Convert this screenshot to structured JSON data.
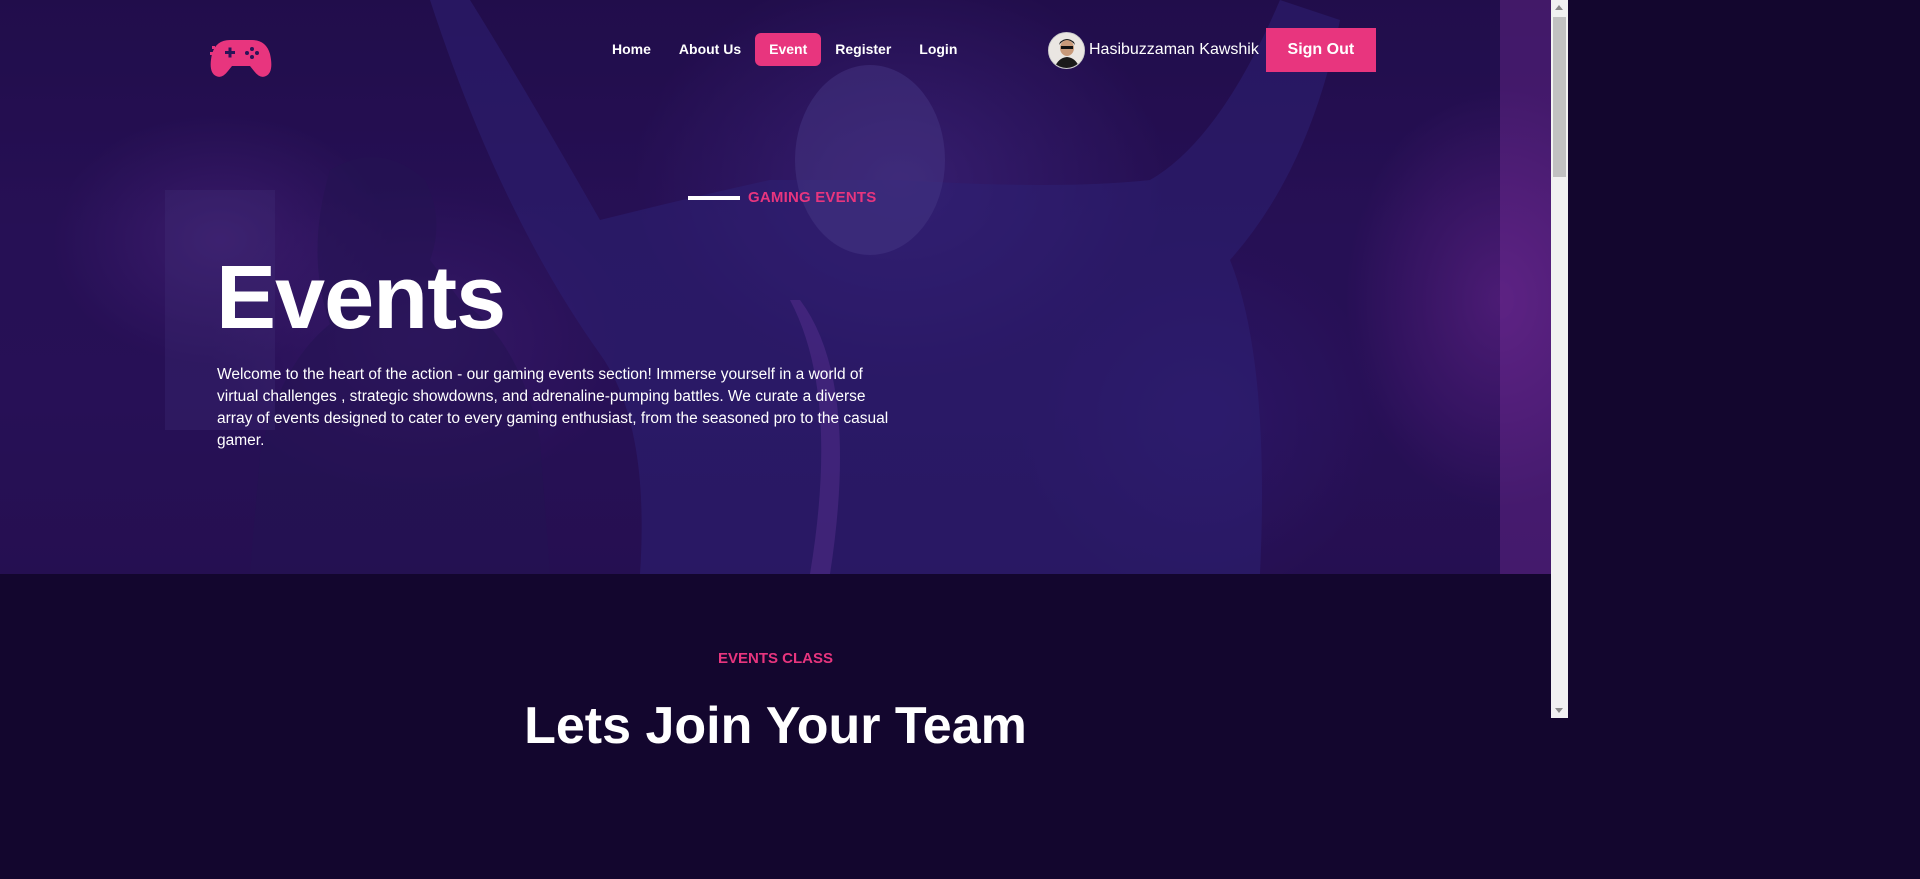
{
  "nav": {
    "items": [
      {
        "label": "Home",
        "active": false
      },
      {
        "label": "About Us",
        "active": false
      },
      {
        "label": "Event",
        "active": true
      },
      {
        "label": "Register",
        "active": false
      },
      {
        "label": "Login",
        "active": false
      }
    ]
  },
  "user": {
    "name": "Hasibuzzaman Kawshik",
    "signout_label": "Sign Out"
  },
  "hero": {
    "eyebrow": "GAMING EVENTS",
    "title": "Events",
    "description": "Welcome to the heart of the action - our gaming events section! Immerse yourself in a world of virtual challenges , strategic showdowns, and adrenaline-pumping battles. We curate a diverse array of events designed to cater to every gaming enthusiast, from the seasoned pro to the casual gamer."
  },
  "section": {
    "eyebrow": "EVENTS CLASS",
    "title": "Lets Join Your Team"
  },
  "colors": {
    "accent": "#e8357e",
    "page_bg": "#13062e",
    "hero_tint": "#2c145e"
  },
  "icons": {
    "logo": "gamepad-icon"
  }
}
